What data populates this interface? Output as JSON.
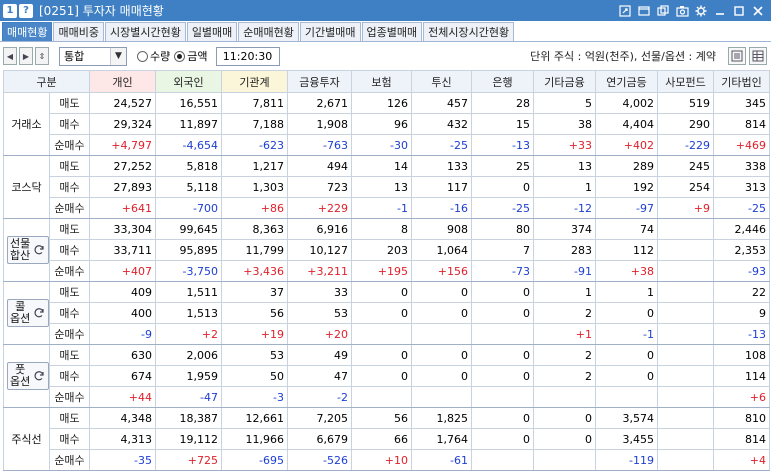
{
  "window": {
    "badge_num": "1",
    "badge_help": "?",
    "title": "[0251] 투자자 매매현황",
    "icons": [
      "link-icon",
      "window-icon",
      "copy-icon",
      "camera-icon",
      "gear-icon",
      "minimize-icon",
      "maximize-icon",
      "close-icon"
    ]
  },
  "tabs": [
    {
      "label": "매매현황",
      "active": true
    },
    {
      "label": "매매비중",
      "active": false
    },
    {
      "label": "시장별시간현황",
      "active": false
    },
    {
      "label": "일별매매",
      "active": false
    },
    {
      "label": "순매매현황",
      "active": false
    },
    {
      "label": "기간별매매",
      "active": false
    },
    {
      "label": "업종별매매",
      "active": false
    },
    {
      "label": "전체시장시간현황",
      "active": false
    }
  ],
  "toolbar": {
    "select_value": "통합",
    "radio_qty": "수량",
    "radio_amt": "금액",
    "radio_selected": "amt",
    "time": "11:20:30",
    "unit_text": "단위 주식 : 억원(천주), 선물/옵션 : 계약"
  },
  "headers": [
    "구분",
    "개인",
    "외국인",
    "기관계",
    "금융투자",
    "보험",
    "투신",
    "은행",
    "기타금융",
    "연기금등",
    "사모펀드",
    "기타법인"
  ],
  "groups": [
    {
      "market": "거래소",
      "market_lines": [
        "거래소"
      ],
      "button": false,
      "rows": [
        {
          "label": "매도",
          "values": [
            "24,527",
            "16,551",
            "7,811",
            "2,671",
            "126",
            "457",
            "28",
            "5",
            "4,002",
            "519",
            "345"
          ]
        },
        {
          "label": "매수",
          "values": [
            "29,324",
            "11,897",
            "7,188",
            "1,908",
            "96",
            "432",
            "15",
            "38",
            "4,404",
            "290",
            "814"
          ]
        },
        {
          "label": "순매수",
          "values": [
            "+4,797",
            "-4,654",
            "-623",
            "-763",
            "-30",
            "-25",
            "-13",
            "+33",
            "+402",
            "-229",
            "+469"
          ]
        }
      ]
    },
    {
      "market": "코스닥",
      "market_lines": [
        "코스닥"
      ],
      "button": false,
      "rows": [
        {
          "label": "매도",
          "values": [
            "27,252",
            "5,818",
            "1,217",
            "494",
            "14",
            "133",
            "25",
            "13",
            "289",
            "245",
            "338"
          ]
        },
        {
          "label": "매수",
          "values": [
            "27,893",
            "5,118",
            "1,303",
            "723",
            "13",
            "117",
            "0",
            "1",
            "192",
            "254",
            "313"
          ]
        },
        {
          "label": "순매수",
          "values": [
            "+641",
            "-700",
            "+86",
            "+229",
            "-1",
            "-16",
            "-25",
            "-12",
            "-97",
            "+9",
            "-25"
          ]
        }
      ]
    },
    {
      "market": "선물합산",
      "market_lines": [
        "선물",
        "합산"
      ],
      "button": true,
      "rows": [
        {
          "label": "매도",
          "values": [
            "33,304",
            "99,645",
            "8,363",
            "6,916",
            "8",
            "908",
            "80",
            "374",
            "74",
            "",
            "2,446"
          ]
        },
        {
          "label": "매수",
          "values": [
            "33,711",
            "95,895",
            "11,799",
            "10,127",
            "203",
            "1,064",
            "7",
            "283",
            "112",
            "",
            "2,353"
          ]
        },
        {
          "label": "순매수",
          "values": [
            "+407",
            "-3,750",
            "+3,436",
            "+3,211",
            "+195",
            "+156",
            "-73",
            "-91",
            "+38",
            "",
            "-93"
          ]
        }
      ]
    },
    {
      "market": "콜옵션",
      "market_lines": [
        "콜",
        "옵션"
      ],
      "button": true,
      "rows": [
        {
          "label": "매도",
          "values": [
            "409",
            "1,511",
            "37",
            "33",
            "0",
            "0",
            "0",
            "1",
            "1",
            "",
            "22"
          ]
        },
        {
          "label": "매수",
          "values": [
            "400",
            "1,513",
            "56",
            "53",
            "0",
            "0",
            "0",
            "2",
            "0",
            "",
            "9"
          ]
        },
        {
          "label": "순매수",
          "values": [
            "-9",
            "+2",
            "+19",
            "+20",
            "",
            "",
            "",
            "+1",
            "-1",
            "",
            "-13"
          ]
        }
      ]
    },
    {
      "market": "풋옵션",
      "market_lines": [
        "풋",
        "옵션"
      ],
      "button": true,
      "rows": [
        {
          "label": "매도",
          "values": [
            "630",
            "2,006",
            "53",
            "49",
            "0",
            "0",
            "0",
            "2",
            "0",
            "",
            "108"
          ]
        },
        {
          "label": "매수",
          "values": [
            "674",
            "1,959",
            "50",
            "47",
            "0",
            "0",
            "0",
            "2",
            "0",
            "",
            "114"
          ]
        },
        {
          "label": "순매수",
          "values": [
            "+44",
            "-47",
            "-3",
            "-2",
            "",
            "",
            "",
            "",
            "",
            "",
            "+6"
          ]
        }
      ]
    },
    {
      "market": "주식선",
      "market_lines": [
        "주식선"
      ],
      "button": false,
      "rows": [
        {
          "label": "매도",
          "values": [
            "4,348",
            "18,387",
            "12,661",
            "7,205",
            "56",
            "1,825",
            "0",
            "0",
            "3,574",
            "",
            "810"
          ]
        },
        {
          "label": "매수",
          "values": [
            "4,313",
            "19,112",
            "11,966",
            "6,679",
            "66",
            "1,764",
            "0",
            "0",
            "3,455",
            "",
            "814"
          ]
        },
        {
          "label": "순매수",
          "values": [
            "-35",
            "+725",
            "-695",
            "-526",
            "+10",
            "-61",
            "",
            "",
            "-119",
            "",
            "+4"
          ]
        }
      ]
    }
  ],
  "colors": {
    "titlebar": "#3f7fc3",
    "positive": "#e0202a",
    "negative": "#1c3ed2"
  }
}
